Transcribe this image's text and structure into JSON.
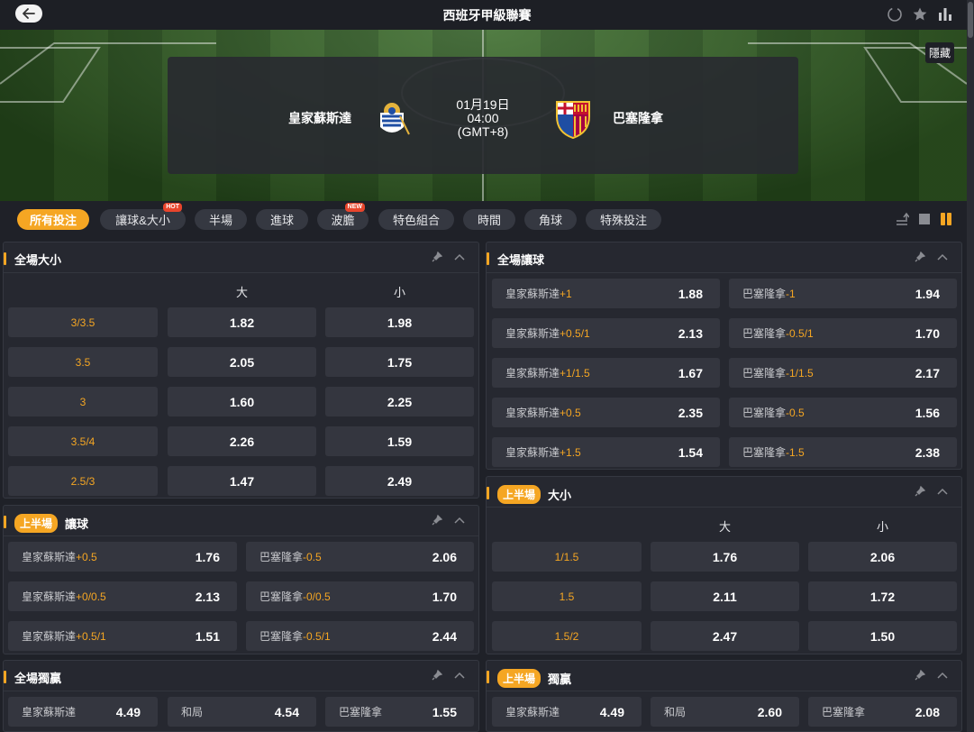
{
  "topbar": {
    "title": "西班牙甲級聯賽"
  },
  "hero": {
    "hide_label": "隱藏",
    "home_team": "皇家蘇斯達",
    "away_team": "巴塞隆拿",
    "date": "01月19日",
    "time": "04:00",
    "timezone": "(GMT+8)"
  },
  "filters": [
    {
      "label": "所有投注",
      "active": true
    },
    {
      "label": "讓球&大小",
      "badge": "HOT"
    },
    {
      "label": "半場"
    },
    {
      "label": "進球"
    },
    {
      "label": "波膽",
      "badge": "NEW"
    },
    {
      "label": "特色組合"
    },
    {
      "label": "時間"
    },
    {
      "label": "角球"
    },
    {
      "label": "特殊投注"
    }
  ],
  "ft_ou": {
    "title": "全場大小",
    "over": "大",
    "under": "小",
    "rows": [
      {
        "line": "3/3.5",
        "over": "1.82",
        "under": "1.98"
      },
      {
        "line": "3.5",
        "over": "2.05",
        "under": "1.75"
      },
      {
        "line": "3",
        "over": "1.60",
        "under": "2.25"
      },
      {
        "line": "3.5/4",
        "over": "2.26",
        "under": "1.59"
      },
      {
        "line": "2.5/3",
        "over": "1.47",
        "under": "2.49"
      }
    ]
  },
  "ft_hdp": {
    "title": "全場讓球",
    "rows": [
      {
        "home": "皇家蘇斯達",
        "home_hcp": "+1",
        "home_odds": "1.88",
        "away": "巴塞隆拿",
        "away_hcp": "-1",
        "away_odds": "1.94"
      },
      {
        "home": "皇家蘇斯達",
        "home_hcp": "+0.5/1",
        "home_odds": "2.13",
        "away": "巴塞隆拿",
        "away_hcp": "-0.5/1",
        "away_odds": "1.70"
      },
      {
        "home": "皇家蘇斯達",
        "home_hcp": "+1/1.5",
        "home_odds": "1.67",
        "away": "巴塞隆拿",
        "away_hcp": "-1/1.5",
        "away_odds": "2.17"
      },
      {
        "home": "皇家蘇斯達",
        "home_hcp": "+0.5",
        "home_odds": "2.35",
        "away": "巴塞隆拿",
        "away_hcp": "-0.5",
        "away_odds": "1.56"
      },
      {
        "home": "皇家蘇斯達",
        "home_hcp": "+1.5",
        "home_odds": "1.54",
        "away": "巴塞隆拿",
        "away_hcp": "-1.5",
        "away_odds": "2.38"
      }
    ]
  },
  "fh_hdp": {
    "badge": "上半場",
    "title": "讓球",
    "rows": [
      {
        "home": "皇家蘇斯達",
        "home_hcp": "+0.5",
        "home_odds": "1.76",
        "away": "巴塞隆拿",
        "away_hcp": "-0.5",
        "away_odds": "2.06"
      },
      {
        "home": "皇家蘇斯達",
        "home_hcp": "+0/0.5",
        "home_odds": "2.13",
        "away": "巴塞隆拿",
        "away_hcp": "-0/0.5",
        "away_odds": "1.70"
      },
      {
        "home": "皇家蘇斯達",
        "home_hcp": "+0.5/1",
        "home_odds": "1.51",
        "away": "巴塞隆拿",
        "away_hcp": "-0.5/1",
        "away_odds": "2.44"
      }
    ]
  },
  "fh_ou": {
    "badge": "上半場",
    "title": "大小",
    "over": "大",
    "under": "小",
    "rows": [
      {
        "line": "1/1.5",
        "over": "1.76",
        "under": "2.06"
      },
      {
        "line": "1.5",
        "over": "2.11",
        "under": "1.72"
      },
      {
        "line": "1.5/2",
        "over": "2.47",
        "under": "1.50"
      }
    ]
  },
  "ft_1x2": {
    "title": "全場獨贏",
    "home": "皇家蘇斯達",
    "home_odds": "4.49",
    "draw": "和局",
    "draw_odds": "4.54",
    "away": "巴塞隆拿",
    "away_odds": "1.55"
  },
  "fh_1x2": {
    "badge": "上半場",
    "title": "獨贏",
    "home": "皇家蘇斯達",
    "home_odds": "4.49",
    "draw": "和局",
    "draw_odds": "2.60",
    "away": "巴塞隆拿",
    "away_odds": "2.08"
  },
  "colors": {
    "accent": "#f5a623",
    "panel": "#262830",
    "cell": "#34363f"
  }
}
